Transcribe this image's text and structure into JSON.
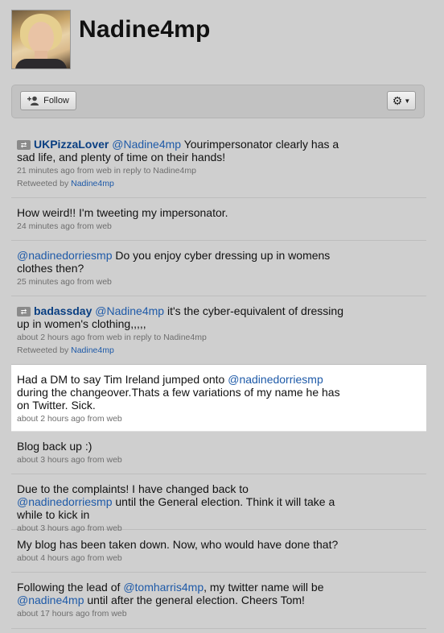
{
  "profile": {
    "username": "Nadine4mp"
  },
  "actions": {
    "follow_label": "Follow",
    "settings_icon": "gear-icon"
  },
  "tweets": [
    {
      "retweet": true,
      "author": "UKPizzaLover",
      "mention": "@Nadine4mp",
      "text": " Yourimpersonator clearly has a sad life, and plenty of time on their hands!",
      "meta": "21 minutes ago from web in reply to Nadine4mp",
      "retweeted_by_label": "Retweeted by ",
      "retweeted_by": "Nadine4mp"
    },
    {
      "text": "How weird!! I'm tweeting my impersonator.",
      "meta": "24 minutes ago from web"
    },
    {
      "mention": "@nadinedorriesmp",
      "text": " Do you enjoy cyber dressing up in womens clothes then?",
      "meta": "25 minutes ago from web"
    },
    {
      "retweet": true,
      "author": "badassday",
      "mention": "@Nadine4mp",
      "text": " it's the cyber-equivalent of dressing up in women's clothing,,,,,",
      "meta": "about 2 hours ago from web in reply to Nadine4mp",
      "retweeted_by_label": "Retweeted by ",
      "retweeted_by": "Nadine4mp"
    },
    {
      "text_before": "Had a DM to say Tim Ireland jumped onto ",
      "mention": "@nadinedorriesmp",
      "text": " during the changeover.Thats a few variations of my name he has on Twitter. Sick.",
      "meta": "about 2 hours ago from web"
    },
    {
      "text": "Blog back up :)",
      "meta": "about 3 hours ago from web"
    },
    {
      "text_before": "Due to the complaints! I have changed back to ",
      "mention": "@nadinedorriesmp",
      "text": " until the General election. Think it will take a while to kick in",
      "meta": "about 3 hours ago from web"
    },
    {
      "text": "My blog has been taken down. Now, who would have done that?",
      "meta": "about 4 hours ago from web"
    },
    {
      "text_before": "Following the lead of ",
      "mention": "@tomharris4mp",
      "text_mid": ", my twitter name will be ",
      "mention2": "@nadine4mp",
      "text": " until after the general election. Cheers Tom!",
      "meta": "about 17 hours ago from web"
    }
  ]
}
